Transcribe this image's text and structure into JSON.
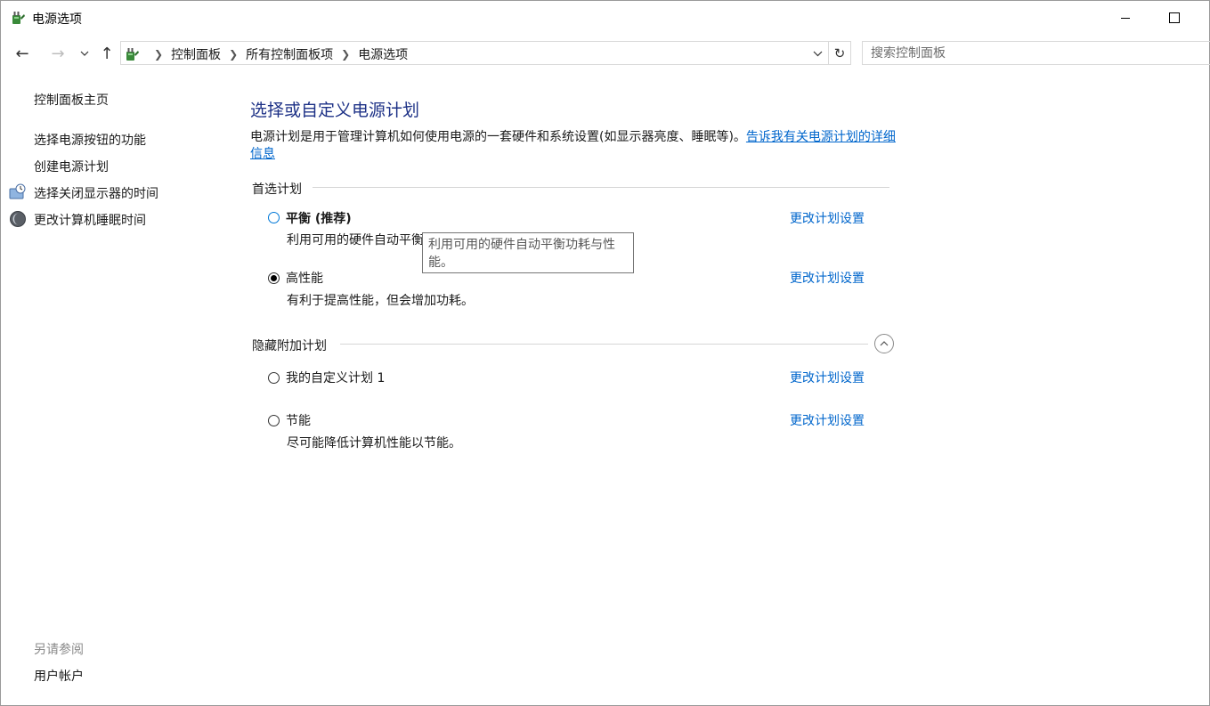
{
  "window": {
    "title": "电源选项"
  },
  "address": {
    "crumbs": [
      "控制面板",
      "所有控制面板项",
      "电源选项"
    ]
  },
  "search": {
    "placeholder": "搜索控制面板"
  },
  "sidebar": {
    "home": "控制面板主页",
    "items": [
      {
        "label": "选择电源按钮的功能"
      },
      {
        "label": "创建电源计划"
      },
      {
        "label": "选择关闭显示器的时间",
        "icon": "display-clock-icon"
      },
      {
        "label": "更改计算机睡眠时间",
        "icon": "moon-icon"
      }
    ],
    "see_also_title": "另请参阅",
    "see_also_items": [
      {
        "label": "用户帐户"
      }
    ]
  },
  "main": {
    "title": "选择或自定义电源计划",
    "description": "电源计划是用于管理计算机如何使用电源的一套硬件和系统设置(如显示器亮度、睡眠等)。",
    "description_link": "告诉我有关电源计划的详细信息",
    "preferred_header": "首选计划",
    "hidden_header": "隐藏附加计划",
    "change_link": "更改计划设置",
    "preferred_plans": [
      {
        "name": "平衡 (推荐)",
        "desc": "利用可用的硬件自动平衡功耗与性能。",
        "desc_visible": "利用可用的硬件自动平衡",
        "selected": false
      },
      {
        "name": "高性能",
        "desc": "有利于提高性能，但会增加功耗。",
        "selected": true
      }
    ],
    "hidden_plans": [
      {
        "name": "我的自定义计划 1",
        "desc": "",
        "selected": false
      },
      {
        "name": "节能",
        "desc": "尽可能降低计算机性能以节能。",
        "selected": false
      }
    ]
  },
  "tooltip": {
    "line1": "利用可用的硬件自动平衡功耗与性",
    "line2": "能。"
  },
  "colors": {
    "link": "#0066cc",
    "title": "#1e3287"
  }
}
